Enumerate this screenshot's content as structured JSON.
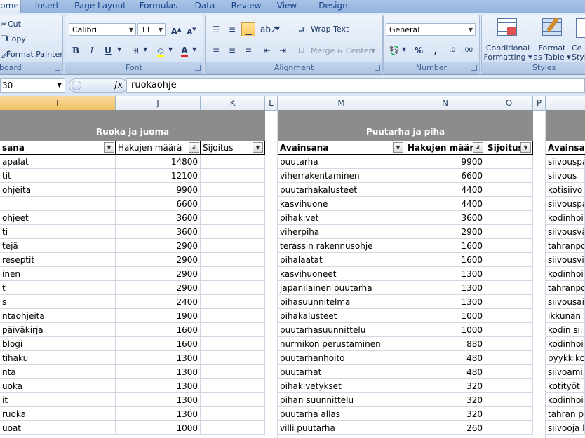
{
  "tabs": [
    "Home",
    "Insert",
    "Page Layout",
    "Formulas",
    "Data",
    "Review",
    "View",
    "Design"
  ],
  "clipboard": {
    "cut": "Cut",
    "copy": "Copy",
    "format_painter": "Format Painter",
    "label": "board"
  },
  "font": {
    "name": "Calibri",
    "size": "11",
    "label": "Font",
    "bold": "B",
    "italic": "I",
    "underline": "U",
    "grow": "A",
    "shrink": "A",
    "font_color": "A"
  },
  "alignment": {
    "wrap_text": "Wrap Text",
    "merge_center": "Merge & Center",
    "label": "Alignment"
  },
  "number": {
    "format": "General",
    "percent": "%",
    "comma": ",",
    "inc_dec": ".0",
    "label": "Number"
  },
  "styles": {
    "conditional": "Conditional",
    "conditional2": "Formatting",
    "format_as": "Format",
    "format_as2": "as Table",
    "cell": "Ce",
    "cell2": "Styl",
    "label": "Styles"
  },
  "formula_bar": {
    "name_box": "30",
    "fx": "fx",
    "content": "ruokaohje"
  },
  "columns": [
    {
      "letter": "I",
      "selected": true
    },
    {
      "letter": "J",
      "selected": false
    },
    {
      "letter": "K",
      "selected": false
    },
    {
      "letter": "L",
      "selected": false
    },
    {
      "letter": "M",
      "selected": false
    },
    {
      "letter": "N",
      "selected": false
    },
    {
      "letter": "O",
      "selected": false
    },
    {
      "letter": "P",
      "selected": false
    },
    {
      "letter": "",
      "selected": false
    }
  ],
  "left_section": {
    "title": "Ruoka ja juoma",
    "headers": [
      "sana",
      "Hakujen määrä",
      "Sijoitus"
    ],
    "rows": [
      [
        "apalat",
        "14800",
        ""
      ],
      [
        "tit",
        "12100",
        ""
      ],
      [
        "ohjeita",
        "9900",
        ""
      ],
      [
        "",
        "6600",
        ""
      ],
      [
        "ohjeet",
        "3600",
        ""
      ],
      [
        "ti",
        "3600",
        ""
      ],
      [
        "tejä",
        "2900",
        ""
      ],
      [
        "reseptit",
        "2900",
        ""
      ],
      [
        "inen",
        "2900",
        ""
      ],
      [
        "t",
        "2900",
        ""
      ],
      [
        "s",
        "2400",
        ""
      ],
      [
        "ntaohjeita",
        "1900",
        ""
      ],
      [
        "päiväkirja",
        "1600",
        ""
      ],
      [
        "blogi",
        "1600",
        ""
      ],
      [
        "tihaku",
        "1300",
        ""
      ],
      [
        "nta",
        "1300",
        ""
      ],
      [
        "uoka",
        "1300",
        ""
      ],
      [
        "it",
        "1300",
        ""
      ],
      [
        "ruoka",
        "1300",
        ""
      ],
      [
        "uoat",
        "1000",
        ""
      ]
    ]
  },
  "mid_section": {
    "title": "Puutarha ja piha",
    "headers": [
      "Avainsana",
      "Hakujen määrä",
      "Sijoitus"
    ],
    "rows": [
      [
        "puutarha",
        "9900",
        ""
      ],
      [
        "viherrakentaminen",
        "6600",
        ""
      ],
      [
        "puutarhakalusteet",
        "4400",
        ""
      ],
      [
        "kasvihuone",
        "4400",
        ""
      ],
      [
        "pihakivet",
        "3600",
        ""
      ],
      [
        "viherpiha",
        "2900",
        ""
      ],
      [
        "terassin rakennusohje",
        "1600",
        ""
      ],
      [
        "pihalaatat",
        "1600",
        ""
      ],
      [
        "kasvihuoneet",
        "1300",
        ""
      ],
      [
        "japanilainen puutarha",
        "1300",
        ""
      ],
      [
        "pihasuunnitelma",
        "1300",
        ""
      ],
      [
        "pihakalusteet",
        "1000",
        ""
      ],
      [
        "puutarhasuunnittelu",
        "1000",
        ""
      ],
      [
        "nurmikon perustaminen",
        "880",
        ""
      ],
      [
        "puutarhanhoito",
        "480",
        ""
      ],
      [
        "puutarhat",
        "480",
        ""
      ],
      [
        "pihakivetykset",
        "320",
        ""
      ],
      [
        "pihan suunnittelu",
        "320",
        ""
      ],
      [
        "puutarha allas",
        "320",
        ""
      ],
      [
        "villi puutarha",
        "260",
        ""
      ]
    ]
  },
  "right_section": {
    "headers": [
      "Avainsa"
    ],
    "rows": [
      "siivouspa",
      "siivous",
      "kotisiivo",
      "siivouspa",
      "kodinhoi",
      "siivousvä",
      "tahranpo",
      "siivousvi",
      "kodinhoi",
      "tahranpo",
      "siivousai",
      "ikkunan p",
      "kodin sii",
      "kodinhoi",
      "pyykkiko",
      "siivoami",
      "kotityöt",
      "kodinhoi",
      "tahran po",
      "siivooja k"
    ]
  }
}
